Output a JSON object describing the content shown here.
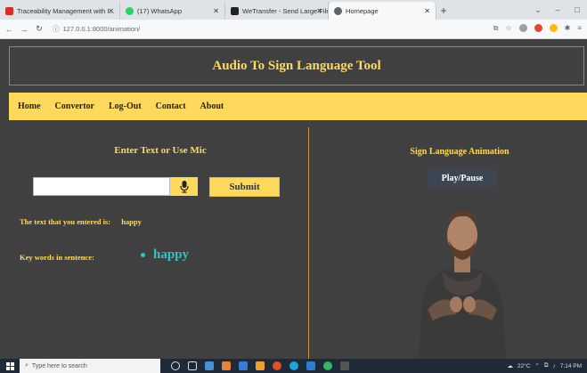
{
  "browser": {
    "tabs": [
      {
        "label": "Traceability Management with I...",
        "favicon_color": "#d93025"
      },
      {
        "label": "(17) WhatsApp",
        "favicon_color": "#25d366"
      },
      {
        "label": "WeTransfer - Send Large Files &...",
        "favicon_color": "#222222"
      },
      {
        "label": "Homepage",
        "favicon_color": "#5f6368",
        "active": true
      }
    ],
    "url": "127.0.0.1:8000/animation/"
  },
  "site": {
    "title": "Audio To Sign Language Tool",
    "nav": [
      "Home",
      "Convertor",
      "Log-Out",
      "Contact",
      "About"
    ]
  },
  "left": {
    "heading": "Enter Text or Use Mic",
    "input_value": "",
    "submit_label": "Submit",
    "entered_label": "The text that you entered is:",
    "entered_value": "happy",
    "keywords_label": "Key words in sentence:",
    "keywords": [
      "happy"
    ]
  },
  "right": {
    "heading": "Sign Language Animation",
    "play_label": "Play/Pause"
  },
  "taskbar": {
    "search_placeholder": "Type here to search",
    "weather": "22°C",
    "time": "7:14 PM"
  },
  "colors": {
    "accent": "#ffd95b",
    "background": "#404040",
    "keyword": "#2ec4c7"
  }
}
